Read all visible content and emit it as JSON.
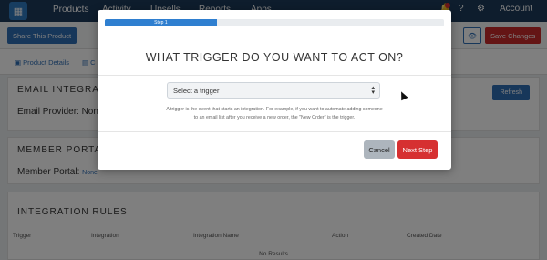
{
  "nav": {
    "items": [
      "Products",
      "Activity",
      "Upsells",
      "Reports",
      "Apps"
    ],
    "account_label": "Account",
    "notification_count": "1"
  },
  "toolbar": {
    "share_label": "Share This Product",
    "save_label": "Save Changes"
  },
  "tabs": {
    "product_details": "Product Details",
    "second_tab": "C"
  },
  "email_section": {
    "heading": "EMAIL INTEGRATIO",
    "provider_label": "Email Provider: Non",
    "refresh_label": "Refresh"
  },
  "member_section": {
    "heading": "MEMBER PORTAL I",
    "portal_label": "Member Portal:",
    "portal_value": "None"
  },
  "rules_section": {
    "heading": "INTEGRATION RULES",
    "columns": [
      "Trigger",
      "Integration",
      "Integration Name",
      "Action",
      "Created Date"
    ],
    "empty_text": "No Results"
  },
  "modal": {
    "step_label": "Step 1",
    "progress_percent": 33,
    "title": "WHAT TRIGGER DO YOU WANT TO ACT ON?",
    "select_value": "Select a trigger",
    "help_text": "A trigger is the event that starts an integration. For example, if you want to automate adding someone to an email list after you receive a new order, the \"New Order\" is the trigger.",
    "cancel_label": "Cancel",
    "next_label": "Next Step"
  },
  "colors": {
    "primary": "#2f6eb5",
    "danger": "#d63031",
    "nav_bg": "#1c3a5a"
  }
}
